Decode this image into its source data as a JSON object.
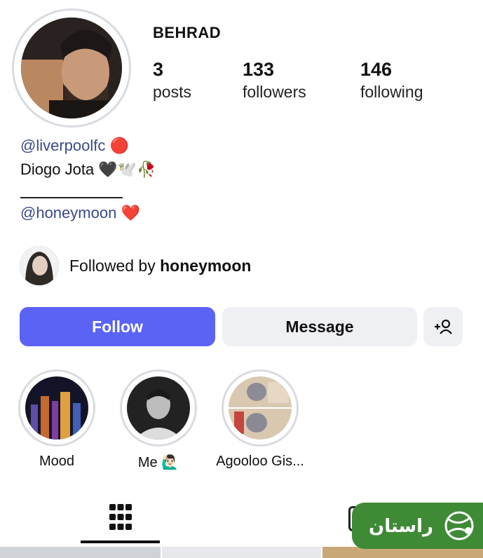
{
  "profile": {
    "username": "BEHRAD",
    "stats": [
      {
        "value": "3",
        "label": "posts"
      },
      {
        "value": "133",
        "label": "followers"
      },
      {
        "value": "146",
        "label": "following"
      }
    ]
  },
  "bio": {
    "line1_mention": "@liverpoolfc",
    "line1_emoji": "🔴",
    "line2_text": "Diogo Jota",
    "line2_emoji": "🖤🕊️🥀",
    "line3_mention": "@honeymoon",
    "line3_emoji": "❤️"
  },
  "followed_by": {
    "prefix": "Followed by ",
    "name": "honeymoon"
  },
  "actions": {
    "follow_label": "Follow",
    "message_label": "Message",
    "add_icon": "+👤"
  },
  "highlights": [
    {
      "label": "Mood"
    },
    {
      "label": "Me 🙋🏻‍♂️"
    },
    {
      "label": "Agooloo Gis..."
    }
  ],
  "badge": {
    "text": "راستان"
  },
  "colors": {
    "follow_button": "#5b63f5",
    "mention": "#3b4a86",
    "badge_bg": "#3e8a35"
  }
}
